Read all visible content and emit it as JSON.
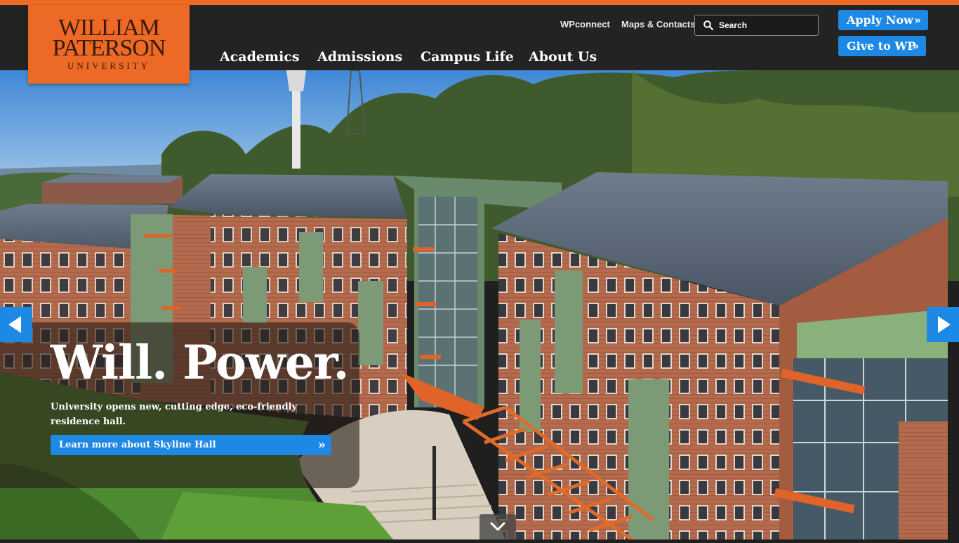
{
  "logo": {
    "line1": "WILLIAM",
    "line2": "PATERSON",
    "line3": "UNIVERSITY"
  },
  "utility": {
    "wpconnect": "WPconnect",
    "maps": "Maps & Contacts",
    "search_placeholder": "Search"
  },
  "buttons": {
    "apply": "Apply Now",
    "give": "Give to WP",
    "chevron": "»"
  },
  "nav": {
    "items": [
      "Academics",
      "Admissions",
      "Campus Life",
      "About Us"
    ]
  },
  "hero": {
    "headline": "Will. Power.",
    "subtext": "University opens new, cutting edge, eco-friendly residence hall.",
    "cta": "Learn more about Skyline Hall"
  },
  "colors": {
    "accent": "#ee6a22",
    "header_bg": "#232323",
    "button_blue": "#1e88e5"
  },
  "icons": {
    "search": "search-icon",
    "prev": "chevron-left-icon",
    "next": "chevron-right-icon",
    "scroll": "chevron-down-icon"
  }
}
